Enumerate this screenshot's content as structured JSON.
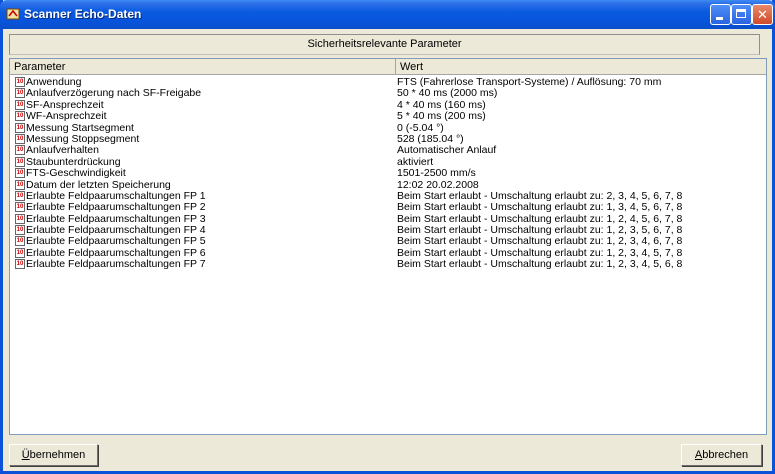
{
  "window": {
    "title": "Scanner Echo-Daten"
  },
  "section_header": "Sicherheitsrelevante Parameter",
  "columns": {
    "param": "Parameter",
    "value": "Wert"
  },
  "rows": [
    {
      "name": "Anwendung",
      "value": "FTS        (Fahrerlose Transport-Systeme)  / Auflösung: 70 mm"
    },
    {
      "name": "Anlaufverzögerung nach SF-Freigabe",
      "value": "50 * 40 ms (2000 ms)"
    },
    {
      "name": "SF-Ansprechzeit",
      "value": "4 * 40 ms (160 ms)"
    },
    {
      "name": "WF-Ansprechzeit",
      "value": "5 * 40 ms (200 ms)"
    },
    {
      "name": "Messung Startsegment",
      "value": "0  (-5.04 °)"
    },
    {
      "name": "Messung Stoppsegment",
      "value": "528  (185.04 °)"
    },
    {
      "name": "Anlaufverhalten",
      "value": "Automatischer Anlauf"
    },
    {
      "name": "Staubunterdrückung",
      "value": "aktiviert"
    },
    {
      "name": "FTS-Geschwindigkeit",
      "value": "1501-2500 mm/s"
    },
    {
      "name": "Datum der letzten Speicherung",
      "value": "12:02 20.02.2008"
    },
    {
      "name": "Erlaubte Feldpaarumschaltungen FP 1",
      "value": "Beim Start erlaubt - Umschaltung erlaubt zu: 2, 3, 4, 5, 6, 7, 8"
    },
    {
      "name": "Erlaubte Feldpaarumschaltungen FP 2",
      "value": "Beim Start erlaubt - Umschaltung erlaubt zu: 1, 3, 4, 5, 6, 7, 8"
    },
    {
      "name": "Erlaubte Feldpaarumschaltungen FP 3",
      "value": "Beim Start erlaubt - Umschaltung erlaubt zu: 1, 2, 4, 5, 6, 7, 8"
    },
    {
      "name": "Erlaubte Feldpaarumschaltungen FP 4",
      "value": "Beim Start erlaubt - Umschaltung erlaubt zu: 1, 2, 3, 5, 6, 7, 8"
    },
    {
      "name": "Erlaubte Feldpaarumschaltungen FP 5",
      "value": "Beim Start erlaubt - Umschaltung erlaubt zu: 1, 2, 3, 4, 6, 7, 8"
    },
    {
      "name": "Erlaubte Feldpaarumschaltungen FP 6",
      "value": "Beim Start erlaubt - Umschaltung erlaubt zu: 1, 2, 3, 4, 5, 7, 8"
    },
    {
      "name": "Erlaubte Feldpaarumschaltungen FP 7",
      "value": "Beim Start erlaubt - Umschaltung erlaubt zu: 1, 2, 3, 4, 5, 6, 8"
    }
  ],
  "buttons": {
    "apply_first": "Ü",
    "apply_rest": "bernehmen",
    "cancel_first": "A",
    "cancel_rest": "bbrechen"
  }
}
